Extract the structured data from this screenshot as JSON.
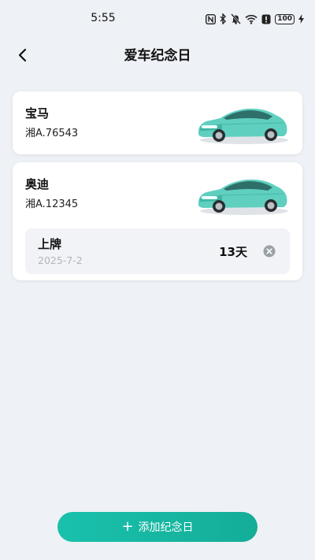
{
  "status_bar": {
    "time": "5:55",
    "battery": "100",
    "icons": [
      "nfc-icon",
      "bluetooth-icon",
      "mute-icon",
      "wifi-icon",
      "alert-icon",
      "battery-icon",
      "charging-icon"
    ]
  },
  "header": {
    "title": "爱车纪念日",
    "back_icon": "chevron-left-icon"
  },
  "cars": [
    {
      "name": "宝马",
      "plate": "湘A.76543",
      "image_icon": "car-illustration"
    },
    {
      "name": "奥迪",
      "plate": "湘A.12345",
      "image_icon": "car-illustration",
      "anniversaries": [
        {
          "name": "上牌",
          "date": "2025-7-2",
          "days": "13天",
          "delete_icon": "close-circle-icon"
        }
      ]
    }
  ],
  "add_button": {
    "label": "添加纪念日",
    "icon": "plus-icon"
  },
  "colors": {
    "background": "#eef1f5",
    "accent": "#19c1ac",
    "car_body": "#5fcfbf"
  }
}
